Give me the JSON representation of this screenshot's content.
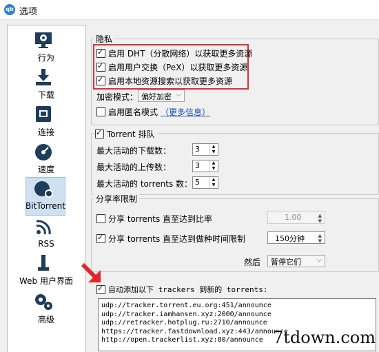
{
  "window": {
    "title": "选项",
    "app_icon": "qbittorrent-icon"
  },
  "sidebar": {
    "items": [
      {
        "label": "行为",
        "icon": "gear-monitor-icon"
      },
      {
        "label": "下载",
        "icon": "download-tray-icon"
      },
      {
        "label": "连接",
        "icon": "network-port-icon"
      },
      {
        "label": "速度",
        "icon": "speedometer-icon"
      },
      {
        "label": "BitTorrent",
        "icon": "globe-gear-icon",
        "active": true
      },
      {
        "label": "RSS",
        "icon": "rss-icon"
      },
      {
        "label": "Web 用户界面",
        "icon": "usb-stick-icon"
      },
      {
        "label": "高级",
        "icon": "gears-icon"
      }
    ]
  },
  "privacy": {
    "title": "隐私",
    "dht": "启用 DHT（分散网络）以获取更多资源",
    "pex": "启用用户交换（PeX）以获取更多资源",
    "lsd": "启用本地资源搜索以获取更多资源",
    "encryption_label": "加密模式：",
    "encryption_value": "偏好加密",
    "anonymous": "启用匿名模式",
    "more_info": "（更多信息）"
  },
  "queue": {
    "title": "Torrent 排队",
    "max_downloads_label": "最大活动的下载数：",
    "max_downloads": "3",
    "max_uploads_label": "最大活动的上传数：",
    "max_uploads": "3",
    "max_torrents_label": "最大活动的 torrents 数：",
    "max_torrents": "5"
  },
  "ratio": {
    "title": "分享率限制",
    "ratio_label": "分享 torrents 直至达到比率",
    "ratio_value": "1.00",
    "time_label": "分享 torrents 直至达到做种时间限制",
    "time_value": "150分钟",
    "then_label": "然后",
    "then_value": "暂停它们"
  },
  "trackers": {
    "label": "自动添加以下 trackers 到新的 torrents:",
    "list": [
      "udp://tracker.torrent.eu.org:451/announce",
      "udp://tracker.iamhansen.xyz:2000/announce",
      "udp://retracker.hotplug.ru:2710/announce",
      "https://tracker.fastdownload.xyz:443/announce",
      "http://open.trackerlist.xyz:80/announce"
    ]
  },
  "watermark": "7tdown.com",
  "colors": {
    "highlight": "#d7323a",
    "arrow": "#e0262b",
    "link": "#1a4fb0",
    "active_item": "#cfe0f1"
  }
}
